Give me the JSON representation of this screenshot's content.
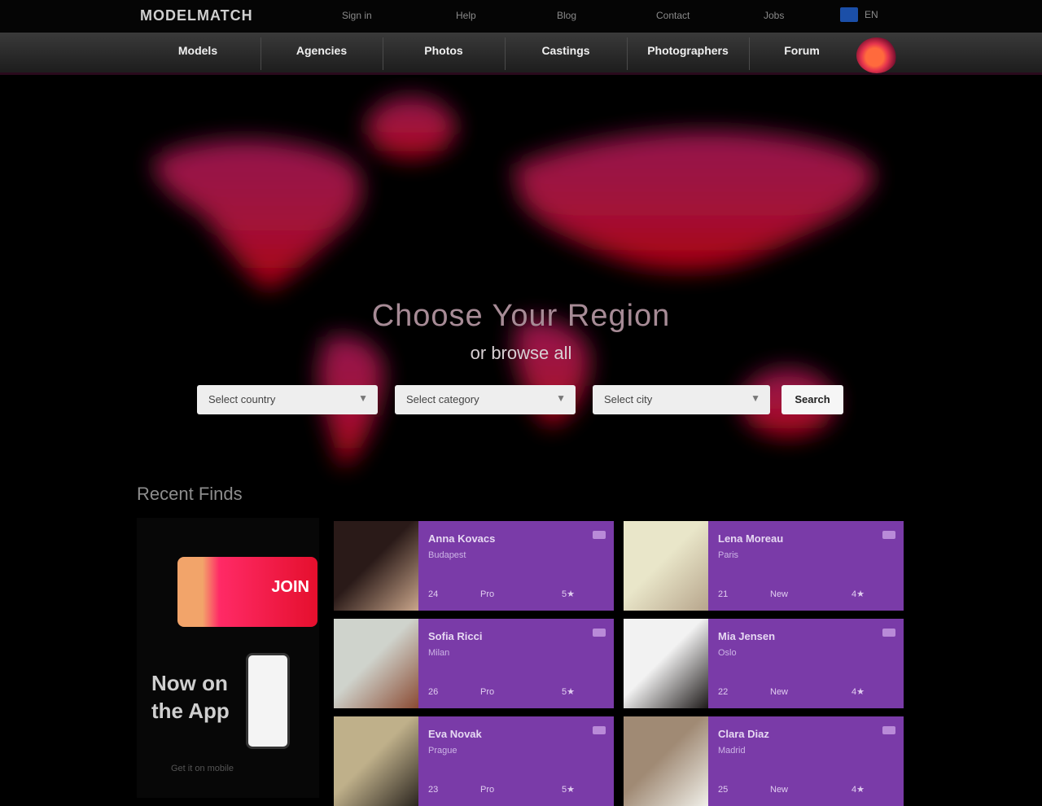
{
  "topbar": {
    "logo": "MODELMATCH",
    "links": [
      "Sign in",
      "Help",
      "Blog",
      "Contact",
      "Jobs"
    ],
    "language": "EN"
  },
  "nav": {
    "items": [
      "Models",
      "Agencies",
      "Photos",
      "Castings",
      "Photographers",
      "Forum"
    ]
  },
  "hero": {
    "title": "Choose Your Region",
    "subtitle": "or browse all",
    "selects": [
      "Select country",
      "Select category",
      "Select city"
    ],
    "search_label": "Search"
  },
  "section_title": "Recent Finds",
  "promo": {
    "banner_text": "JOIN",
    "headline": "Now on the App",
    "footer": "Get it on mobile"
  },
  "cards": [
    {
      "name": "Anna Kovacs",
      "meta": "Budapest",
      "stats": [
        "24",
        "Pro",
        "5★"
      ],
      "photo_colors": [
        "#2a1a18",
        "#c9a58a"
      ]
    },
    {
      "name": "Lena Moreau",
      "meta": "Paris",
      "stats": [
        "21",
        "New",
        "4★"
      ],
      "photo_colors": [
        "#e9e6c9",
        "#b7a58c"
      ]
    },
    {
      "name": "Sofia Ricci",
      "meta": "Milan",
      "stats": [
        "26",
        "Pro",
        "5★"
      ],
      "photo_colors": [
        "#cfd3cc",
        "#8a4a32"
      ]
    },
    {
      "name": "Mia Jensen",
      "meta": "Oslo",
      "stats": [
        "22",
        "New",
        "4★"
      ],
      "photo_colors": [
        "#f2f2f2",
        "#1e1a19"
      ]
    },
    {
      "name": "Eva Novak",
      "meta": "Prague",
      "stats": [
        "23",
        "Pro",
        "5★"
      ],
      "photo_colors": [
        "#bfb08a",
        "#2c2620"
      ]
    },
    {
      "name": "Clara Diaz",
      "meta": "Madrid",
      "stats": [
        "25",
        "New",
        "4★"
      ],
      "photo_colors": [
        "#a08a74",
        "#f0efe9"
      ]
    }
  ]
}
